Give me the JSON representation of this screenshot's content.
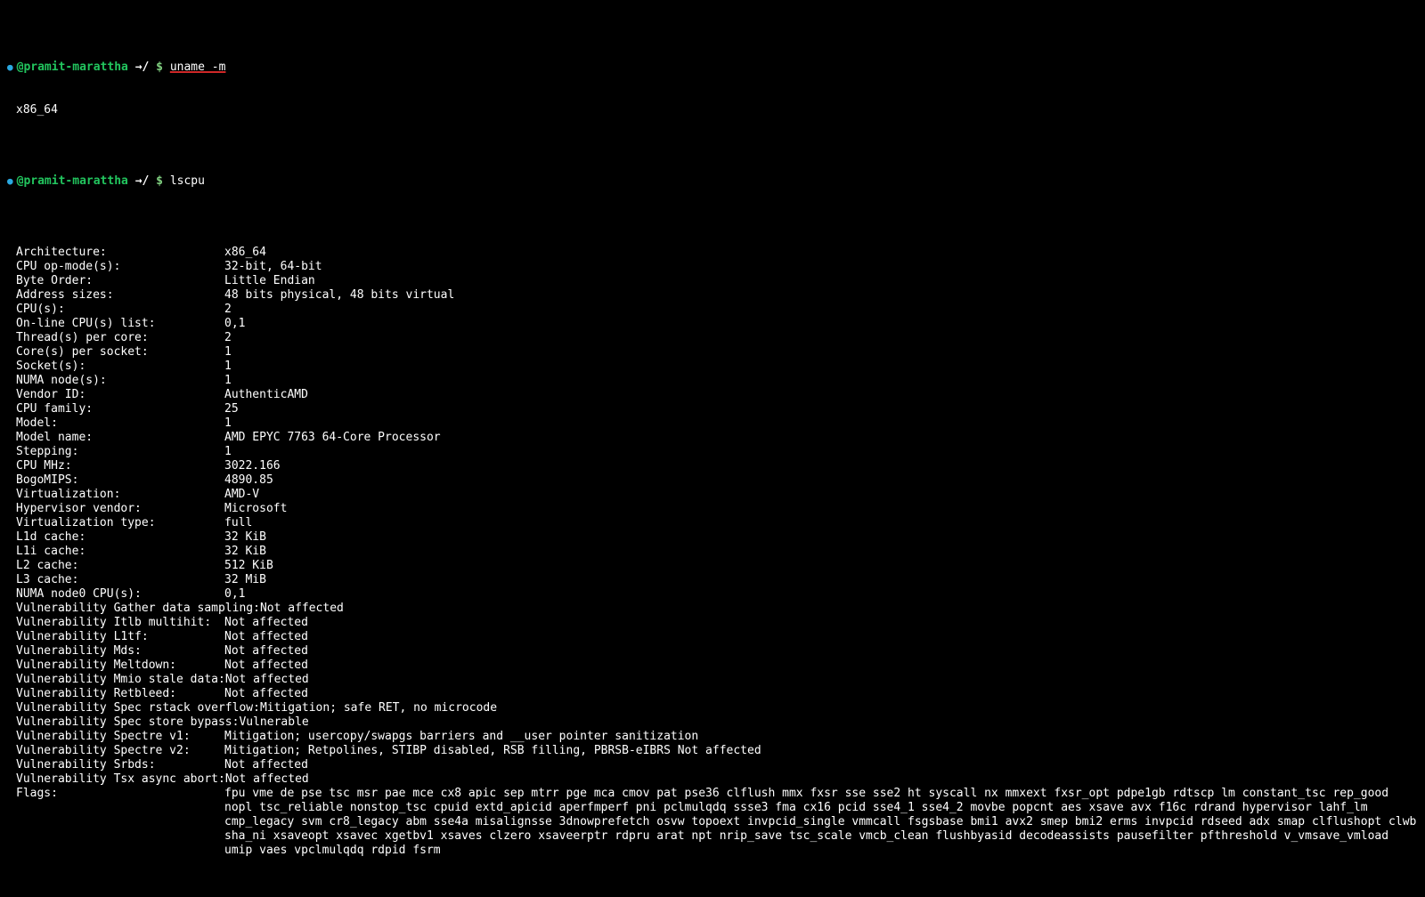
{
  "prompts": {
    "user": "@pramit-marattha",
    "arrow": "→/",
    "dollar": "$",
    "cmd1": "uname -m",
    "cmd2": "lscpu"
  },
  "uname_output": "x86_64",
  "lscpu": [
    {
      "key": "Architecture:",
      "val": "x86_64"
    },
    {
      "key": "CPU op-mode(s):",
      "val": "32-bit, 64-bit"
    },
    {
      "key": "Byte Order:",
      "val": "Little Endian"
    },
    {
      "key": "Address sizes:",
      "val": "48 bits physical, 48 bits virtual"
    },
    {
      "key": "CPU(s):",
      "val": "2"
    },
    {
      "key": "On-line CPU(s) list:",
      "val": "0,1"
    },
    {
      "key": "Thread(s) per core:",
      "val": "2"
    },
    {
      "key": "Core(s) per socket:",
      "val": "1"
    },
    {
      "key": "Socket(s):",
      "val": "1"
    },
    {
      "key": "NUMA node(s):",
      "val": "1"
    },
    {
      "key": "Vendor ID:",
      "val": "AuthenticAMD"
    },
    {
      "key": "CPU family:",
      "val": "25"
    },
    {
      "key": "Model:",
      "val": "1"
    },
    {
      "key": "Model name:",
      "val": "AMD EPYC 7763 64-Core Processor"
    },
    {
      "key": "Stepping:",
      "val": "1"
    },
    {
      "key": "CPU MHz:",
      "val": "3022.166"
    },
    {
      "key": "BogoMIPS:",
      "val": "4890.85"
    },
    {
      "key": "Virtualization:",
      "val": "AMD-V"
    },
    {
      "key": "Hypervisor vendor:",
      "val": "Microsoft"
    },
    {
      "key": "Virtualization type:",
      "val": "full"
    },
    {
      "key": "L1d cache:",
      "val": "32 KiB"
    },
    {
      "key": "L1i cache:",
      "val": "32 KiB"
    },
    {
      "key": "L2 cache:",
      "val": "512 KiB"
    },
    {
      "key": "L3 cache:",
      "val": "32 MiB"
    },
    {
      "key": "NUMA node0 CPU(s):",
      "val": "0,1"
    },
    {
      "key": "Vulnerability Gather data sampling:",
      "val": "Not affected"
    },
    {
      "key": "Vulnerability Itlb multihit:",
      "val": "Not affected"
    },
    {
      "key": "Vulnerability L1tf:",
      "val": "Not affected"
    },
    {
      "key": "Vulnerability Mds:",
      "val": "Not affected"
    },
    {
      "key": "Vulnerability Meltdown:",
      "val": "Not affected"
    },
    {
      "key": "Vulnerability Mmio stale data:",
      "val": "Not affected"
    },
    {
      "key": "Vulnerability Retbleed:",
      "val": "Not affected"
    },
    {
      "key": "Vulnerability Spec rstack overflow:",
      "val": "Mitigation; safe RET, no microcode"
    },
    {
      "key": "Vulnerability Spec store bypass:",
      "val": "Vulnerable"
    },
    {
      "key": "Vulnerability Spectre v1:",
      "val": "Mitigation; usercopy/swapgs barriers and __user pointer sanitization"
    },
    {
      "key": "Vulnerability Spectre v2:",
      "val": "Mitigation; Retpolines, STIBP disabled, RSB filling, PBRSB-eIBRS Not affected"
    },
    {
      "key": "Vulnerability Srbds:",
      "val": "Not affected"
    },
    {
      "key": "Vulnerability Tsx async abort:",
      "val": "Not affected"
    },
    {
      "key": "Flags:",
      "val": "fpu vme de pse tsc msr pae mce cx8 apic sep mtrr pge mca cmov pat pse36 clflush mmx fxsr sse sse2 ht syscall nx mmxext fxsr_opt pdpe1gb rdtscp lm constant_tsc rep_good nopl tsc_reliable nonstop_tsc cpuid extd_apicid aperfmperf pni pclmulqdq ssse3 fma cx16 pcid sse4_1 sse4_2 movbe popcnt aes xsave avx f16c rdrand hypervisor lahf_lm cmp_legacy svm cr8_legacy abm sse4a misalignsse 3dnowprefetch osvw topoext invpcid_single vmmcall fsgsbase bmi1 avx2 smep bmi2 erms invpcid rdseed adx smap clflushopt clwb sha_ni xsaveopt xsavec xgetbv1 xsaves clzero xsaveerptr rdpru arat npt nrip_save tsc_scale vmcb_clean flushbyasid decodeassists pausefilter pfthreshold v_vmsave_vmload umip vaes vpclmulqdq rdpid fsrm"
    }
  ]
}
